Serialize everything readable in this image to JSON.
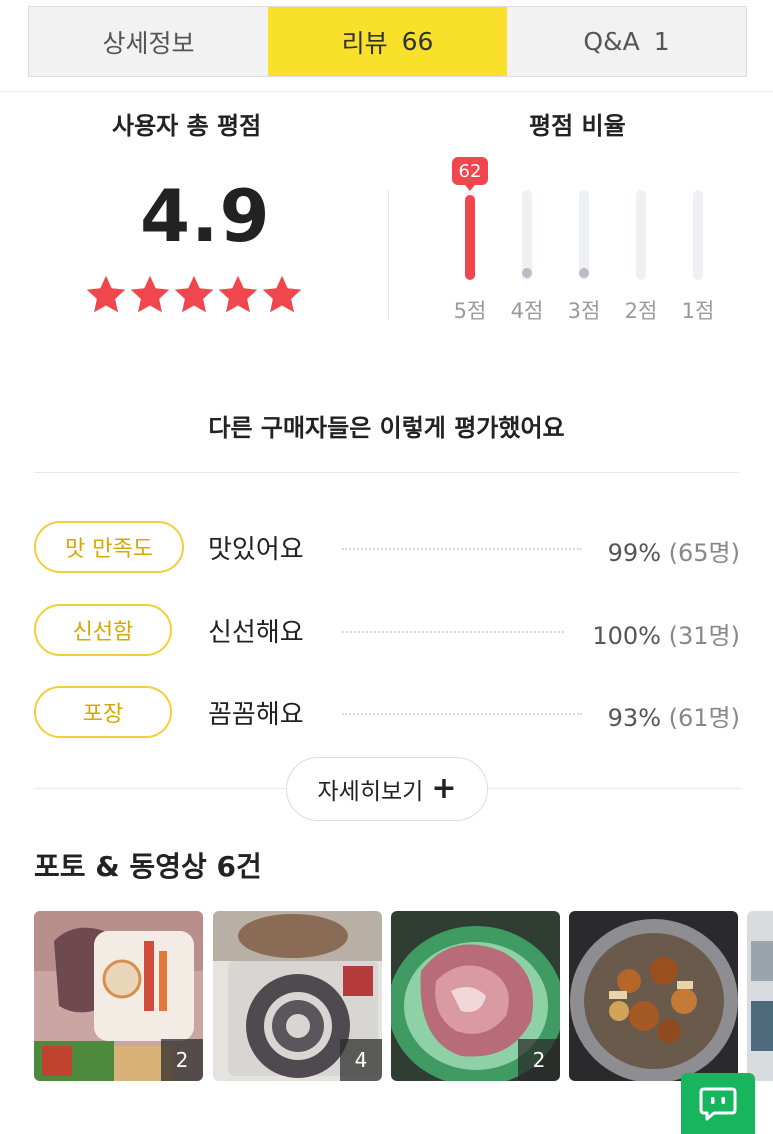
{
  "tabs": [
    {
      "label": "상세정보",
      "count": ""
    },
    {
      "label": "리뷰",
      "count": "66"
    },
    {
      "label": "Q&A",
      "count": "1"
    }
  ],
  "rating": {
    "title": "사용자 총 평점",
    "score": "4.9",
    "stars": 5,
    "star_color": "#f0474e"
  },
  "ratio": {
    "title": "평점 비율",
    "bars": [
      {
        "label": "5점",
        "count": 62,
        "fraction": 0.94,
        "badge": "62"
      },
      {
        "label": "4점",
        "count": 2,
        "fraction": 0.03,
        "badge": ""
      },
      {
        "label": "3점",
        "count": 2,
        "fraction": 0.03,
        "badge": ""
      },
      {
        "label": "2점",
        "count": 0,
        "fraction": 0,
        "badge": ""
      },
      {
        "label": "1점",
        "count": 0,
        "fraction": 0,
        "badge": ""
      }
    ]
  },
  "others": {
    "title": "다른 구매자들은 이렇게 평가했어요",
    "rows": [
      {
        "category": "맛 만족도",
        "answer": "맛있어요",
        "percent": "99%",
        "people": "(65명)"
      },
      {
        "category": "신선함",
        "answer": "신선해요",
        "percent": "100%",
        "people": "(31명)"
      },
      {
        "category": "포장",
        "answer": "꼼꼼해요",
        "percent": "93%",
        "people": "(61명)"
      }
    ],
    "more_label": "자세히보기",
    "more_icon": "plus-icon"
  },
  "photos": {
    "title": "포토 & 동영상 6건",
    "items": [
      {
        "name": "packaged-meat-photo",
        "count": "2"
      },
      {
        "name": "sausage-photo",
        "count": "4"
      },
      {
        "name": "raw-meat-photo",
        "count": "2"
      },
      {
        "name": "cooked-dish-photo",
        "count": ""
      }
    ]
  },
  "colors": {
    "accent_yellow": "#f9e02b",
    "bar_red": "#f0474e",
    "chat_green": "#16b55e"
  },
  "chat_icon": "chat-icon"
}
